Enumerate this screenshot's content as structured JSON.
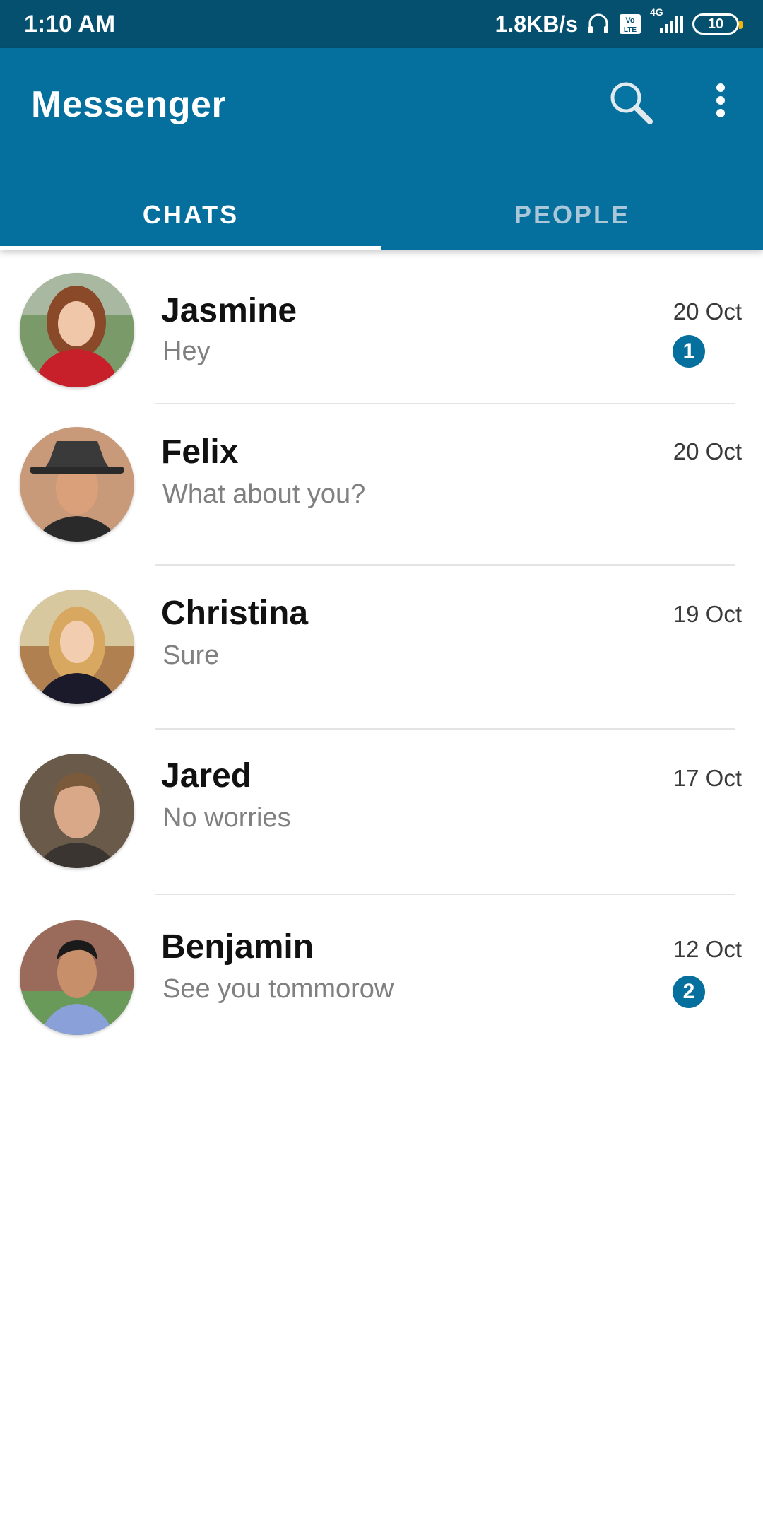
{
  "status_bar": {
    "time": "1:10 AM",
    "net_speed": "1.8KB/s",
    "network": "4G",
    "battery": "10",
    "icons": [
      "headset-icon",
      "volte-icon",
      "signal-icon",
      "battery-icon"
    ]
  },
  "app_bar": {
    "title": "Messenger",
    "icons": [
      "search-icon",
      "more-vert-icon"
    ]
  },
  "tabs": [
    {
      "label": "CHATS",
      "active": true
    },
    {
      "label": "PEOPLE",
      "active": false
    }
  ],
  "chats": [
    {
      "name": "Jasmine",
      "message": "Hey",
      "date": "20 Oct",
      "unread": "1"
    },
    {
      "name": "Felix",
      "message": "What about you?",
      "date": "20 Oct",
      "unread": ""
    },
    {
      "name": "Christina",
      "message": "Sure",
      "date": "19 Oct",
      "unread": ""
    },
    {
      "name": "Jared",
      "message": "No worries",
      "date": "17 Oct",
      "unread": ""
    },
    {
      "name": "Benjamin",
      "message": "See you tommorow",
      "date": "12 Oct",
      "unread": "2"
    }
  ],
  "colors": {
    "status_bar": "#05506f",
    "primary": "#05709d",
    "badge": "#05709d"
  }
}
